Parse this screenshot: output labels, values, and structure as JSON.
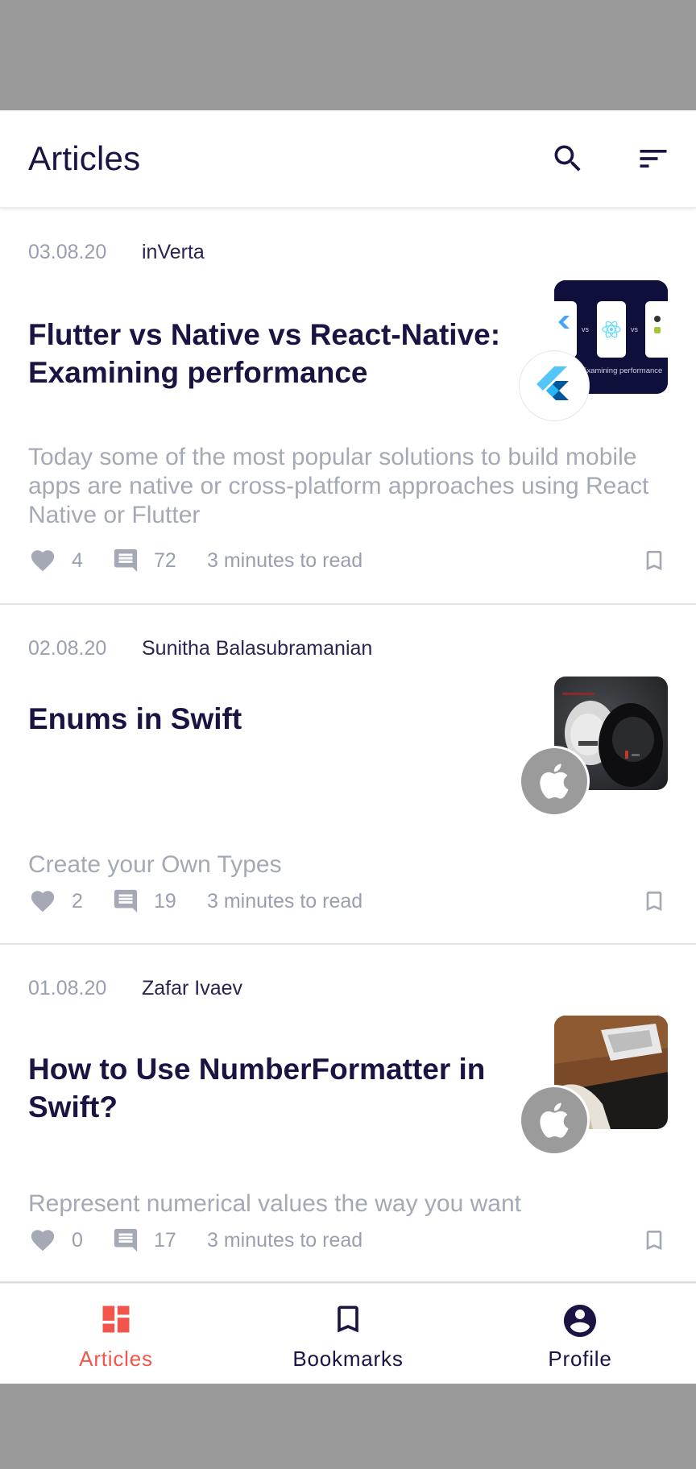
{
  "header": {
    "title": "Articles"
  },
  "colors": {
    "accent": "#f2554b",
    "dark": "#1c1343",
    "muted": "#9a9fb0"
  },
  "articles": [
    {
      "date": "03.08.20",
      "author": "inVerta",
      "title": "Flutter vs Native vs React-Native: Examining performance",
      "excerpt": "Today some of the most popular solutions to build mobile apps are native or cross-platform approaches using React Native or Flutter",
      "likes": "4",
      "comments": "72",
      "read_time": "3 minutes to read",
      "category_icon": "flutter-icon",
      "thumbnail_caption": "Examining performance",
      "thumbnail_vs": "vs"
    },
    {
      "date": "02.08.20",
      "author": "Sunitha Balasubramanian",
      "title": "Enums in Swift",
      "excerpt": "Create your Own Types",
      "likes": "2",
      "comments": "19",
      "read_time": "3 minutes to read",
      "category_icon": "apple-icon"
    },
    {
      "date": "01.08.20",
      "author": "Zafar Ivaev",
      "title": "How to Use NumberFormatter in Swift?",
      "excerpt": "Represent numerical values the way you want",
      "likes": "0",
      "comments": "17",
      "read_time": "3 minutes to read",
      "category_icon": "apple-icon"
    }
  ],
  "bottom_nav": [
    {
      "label": "Articles",
      "icon": "grid-icon",
      "active": true
    },
    {
      "label": "Bookmarks",
      "icon": "bookmark-icon",
      "active": false
    },
    {
      "label": "Profile",
      "icon": "account-circle-icon",
      "active": false
    }
  ]
}
